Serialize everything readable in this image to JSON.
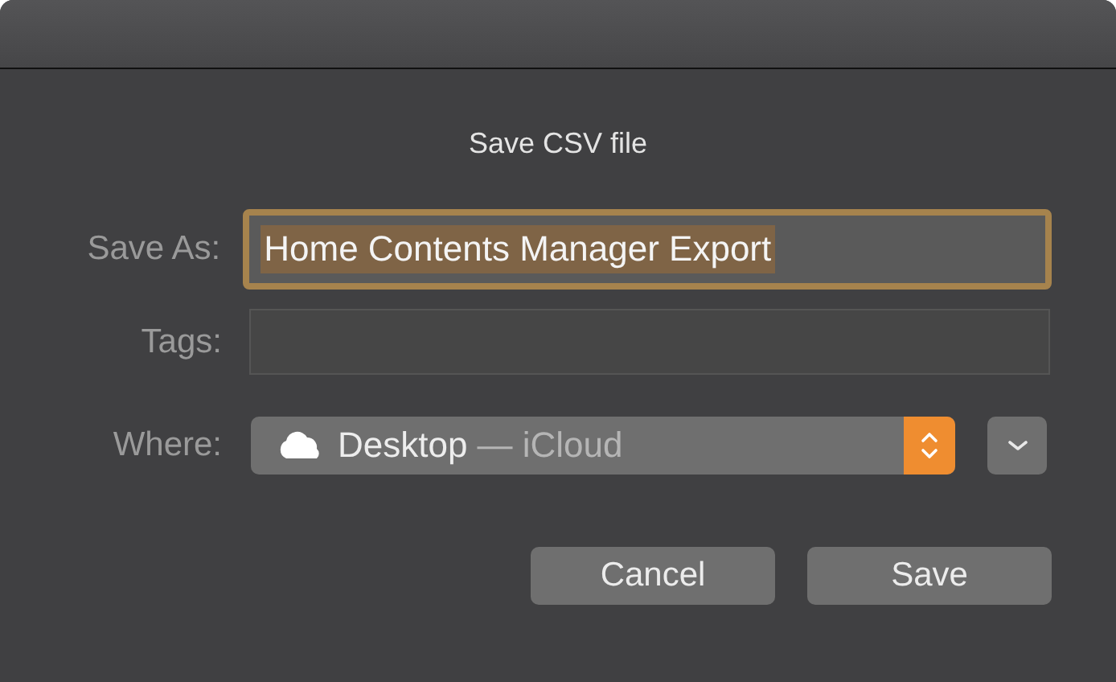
{
  "dialog": {
    "title": "Save CSV file"
  },
  "save_as": {
    "label": "Save As:",
    "value": "Home Contents Manager Export",
    "focused": true,
    "text_selected": true
  },
  "tags": {
    "label": "Tags:"
  },
  "where": {
    "label": "Where:",
    "location": "Desktop",
    "detail": "— iCloud"
  },
  "buttons": [
    {
      "label": "Cancel"
    },
    {
      "label": "Save"
    }
  ]
}
